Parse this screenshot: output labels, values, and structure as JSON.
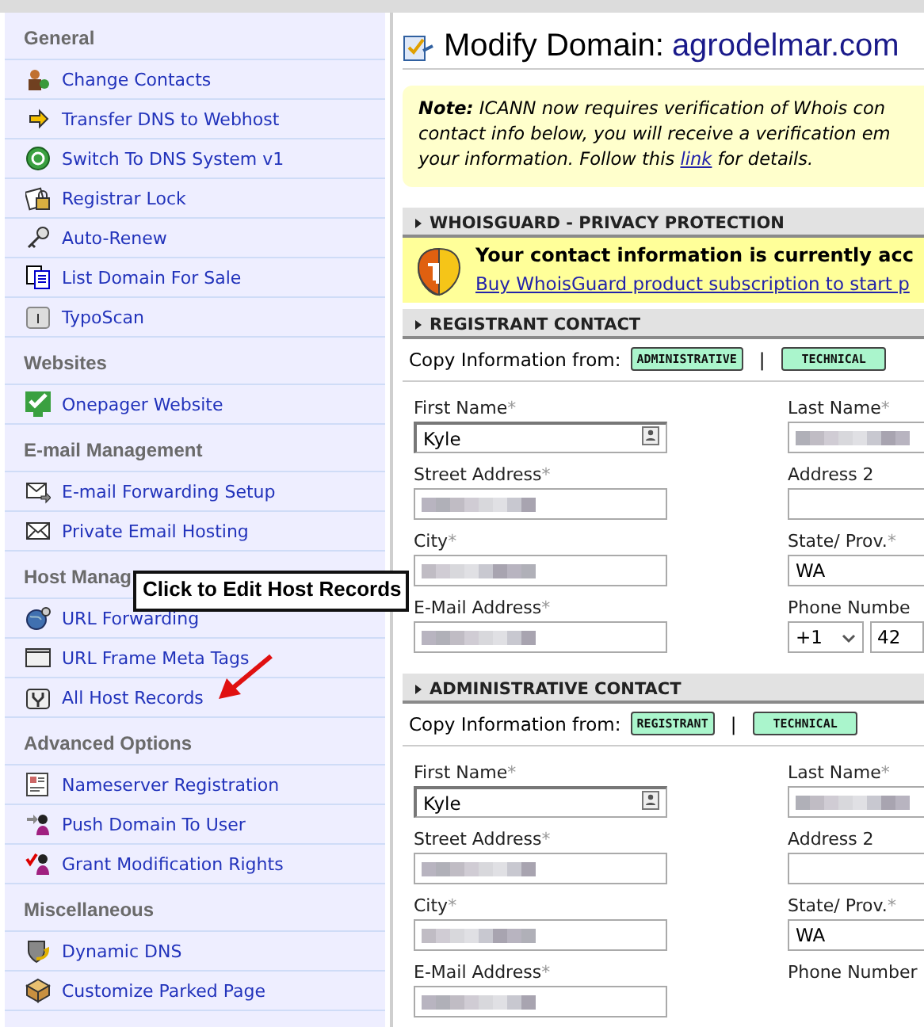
{
  "sidebar": {
    "sections": [
      {
        "title": "General",
        "items": [
          {
            "label": "Change Contacts"
          },
          {
            "label": "Transfer DNS to Webhost"
          },
          {
            "label": "Switch To DNS System v1"
          },
          {
            "label": "Registrar Lock"
          },
          {
            "label": "Auto-Renew"
          },
          {
            "label": "List Domain For Sale"
          },
          {
            "label": "TypoScan"
          }
        ]
      },
      {
        "title": "Websites",
        "items": [
          {
            "label": "Onepager Website"
          }
        ]
      },
      {
        "title": "E-mail Management",
        "items": [
          {
            "label": "E-mail Forwarding Setup"
          },
          {
            "label": "Private Email Hosting"
          }
        ]
      },
      {
        "title": "Host Manag",
        "items": [
          {
            "label": "URL Forwarding"
          },
          {
            "label": "URL Frame Meta Tags"
          },
          {
            "label": "All Host Records"
          }
        ]
      },
      {
        "title": "Advanced Options",
        "items": [
          {
            "label": "Nameserver Registration"
          },
          {
            "label": "Push Domain To User"
          },
          {
            "label": "Grant Modification Rights"
          }
        ]
      },
      {
        "title": "Miscellaneous",
        "items": [
          {
            "label": "Dynamic DNS"
          },
          {
            "label": "Customize Parked Page"
          }
        ]
      }
    ]
  },
  "callout": {
    "text": "Click to Edit Host Records"
  },
  "title": {
    "label": "Modify Domain:",
    "domain": "agrodelmar.com"
  },
  "note": {
    "lines": [
      {
        "text": "**Note:** ICANN now requires verification of Whois con"
      },
      {
        "text": "contact info below, you will receive a verification em"
      },
      {
        "text": "your information. Follow this ",
        "link": "link",
        "after": " for details."
      }
    ]
  },
  "whoisguard": {
    "header": "WHOISGUARD - PRIVACY PROTECTION",
    "message": "Your contact information is currently acc",
    "link": "Buy WhoisGuard product subscription to start p"
  },
  "contacts": [
    {
      "header": "REGISTRANT CONTACT",
      "copy_label": "Copy Information from:",
      "copy_buttons": [
        "ADMINISTRATIVE",
        "TECHNICAL"
      ],
      "separator": "|",
      "rows": [
        [
          {
            "label": "First Name",
            "mark": "*",
            "kind": "autofill",
            "value": "Kyle"
          },
          {
            "label": "Last Name",
            "mark": "*",
            "kind": "redacted"
          }
        ],
        [
          {
            "label": "Street Address",
            "mark": "*",
            "kind": "redacted"
          },
          {
            "label": "Address 2",
            "kind": "text"
          }
        ],
        [
          {
            "label": "City",
            "mark": "*",
            "kind": "redacted"
          },
          {
            "label": "State/ Prov.",
            "mark": "*",
            "kind": "text",
            "value": "WA"
          }
        ],
        [
          {
            "label": "E-Mail Address",
            "mark": "*",
            "kind": "redacted"
          },
          {
            "label": "Phone Numbe",
            "kind": "phone",
            "code": "+1",
            "value": "42"
          }
        ]
      ]
    },
    {
      "header": "ADMINISTRATIVE CONTACT",
      "copy_label": "Copy Information from:",
      "copy_buttons": [
        "REGISTRANT",
        "TECHNICAL"
      ],
      "separator": "|",
      "rows": [
        [
          {
            "label": "First Name",
            "mark": "*",
            "kind": "autofill",
            "value": "Kyle"
          },
          {
            "label": "Last Name",
            "mark": "*",
            "kind": "redacted"
          }
        ],
        [
          {
            "label": "Street Address",
            "mark": "*",
            "kind": "redacted"
          },
          {
            "label": "Address 2",
            "kind": "text"
          }
        ],
        [
          {
            "label": "City",
            "mark": "*",
            "kind": "redacted"
          },
          {
            "label": "State/ Prov.",
            "mark": "*",
            "kind": "text",
            "value": "WA"
          }
        ],
        [
          {
            "label": "E-Mail Address",
            "mark": "*",
            "kind": "redacted"
          },
          {
            "label": "Phone Number",
            "kind": "label-only"
          }
        ]
      ]
    }
  ]
}
